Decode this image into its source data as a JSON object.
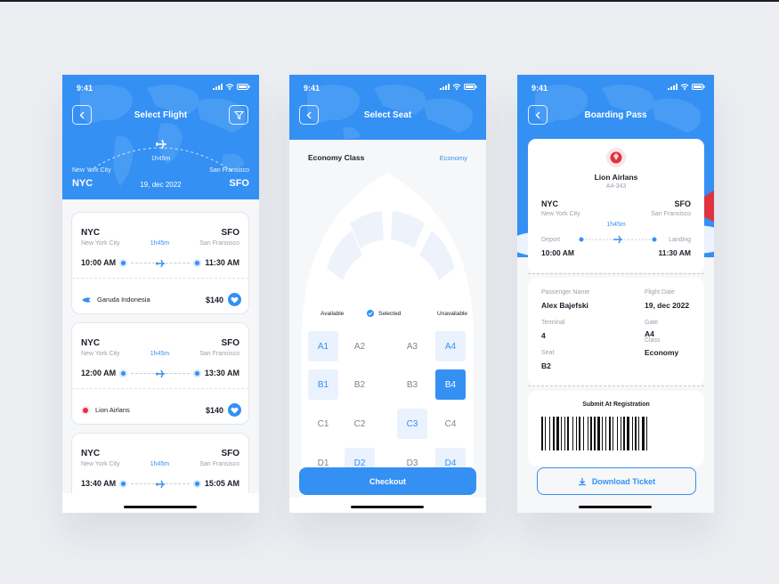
{
  "status_time": "9:41",
  "flight_screen": {
    "title": "Select Flight",
    "from_city": "New York City",
    "from_code": "NYC",
    "to_city": "San Fransisco",
    "to_code": "SFO",
    "duration": "1h45m",
    "date": "19, dec 2022",
    "flights": [
      {
        "from_code": "NYC",
        "from_city": "New York City",
        "duration": "1h45m",
        "to_code": "SFO",
        "to_city": "San Fransisco",
        "depart": "10:00 AM",
        "arrive": "11:30 AM",
        "airline": "Garuda Indonesia",
        "price": "$140"
      },
      {
        "from_code": "NYC",
        "from_city": "New York City",
        "duration": "1h45m",
        "to_code": "SFO",
        "to_city": "San Fransisco",
        "depart": "12:00 AM",
        "arrive": "13:30 AM",
        "airline": "Lion Airlans",
        "price": "$140"
      },
      {
        "from_code": "NYC",
        "from_city": "New York City",
        "duration": "1h45m",
        "to_code": "SFO",
        "to_city": "San Fransisco",
        "depart": "13:40 AM",
        "arrive": "15:05 AM"
      }
    ]
  },
  "seat_screen": {
    "title": "Select Seat",
    "class_label": "Economy Class",
    "class_value": "Economy",
    "legend": {
      "available": "Available",
      "selected": "Selected",
      "unavailable": "Unavailable"
    },
    "seats": [
      "A1",
      "A2",
      "A3",
      "A4",
      "B1",
      "B2",
      "B3",
      "B4",
      "C1",
      "C2",
      "C3",
      "C4",
      "D1",
      "D2",
      "D3",
      "D4"
    ],
    "checkout": "Checkout"
  },
  "boarding_screen": {
    "title": "Boarding Pass",
    "airline": "Lion Airlans",
    "flight_no": "A4-343",
    "from_code": "NYC",
    "from_city": "New York City",
    "to_code": "SFO",
    "to_city": "San Fransisco",
    "duration": "1h45m",
    "depart_label": "Deport",
    "depart_time": "10:00 AM",
    "arrive_label": "Landing",
    "arrive_time": "11:30 AM",
    "passenger_label": "Passenger Name",
    "passenger": "Alex Bajefski",
    "date_label": "Flight Date",
    "date": "19, dec 2022",
    "terminal_label": "Terminal",
    "terminal": "4",
    "gate_label": "Gate",
    "gate": "A4",
    "class_label": "Class",
    "class": "Economy",
    "seat_label": "Seat",
    "seat": "B2",
    "submit": "Submit At Registration",
    "download": "Download Ticket"
  },
  "colors": {
    "accent": "#3490f3",
    "background": "#eceef2"
  }
}
